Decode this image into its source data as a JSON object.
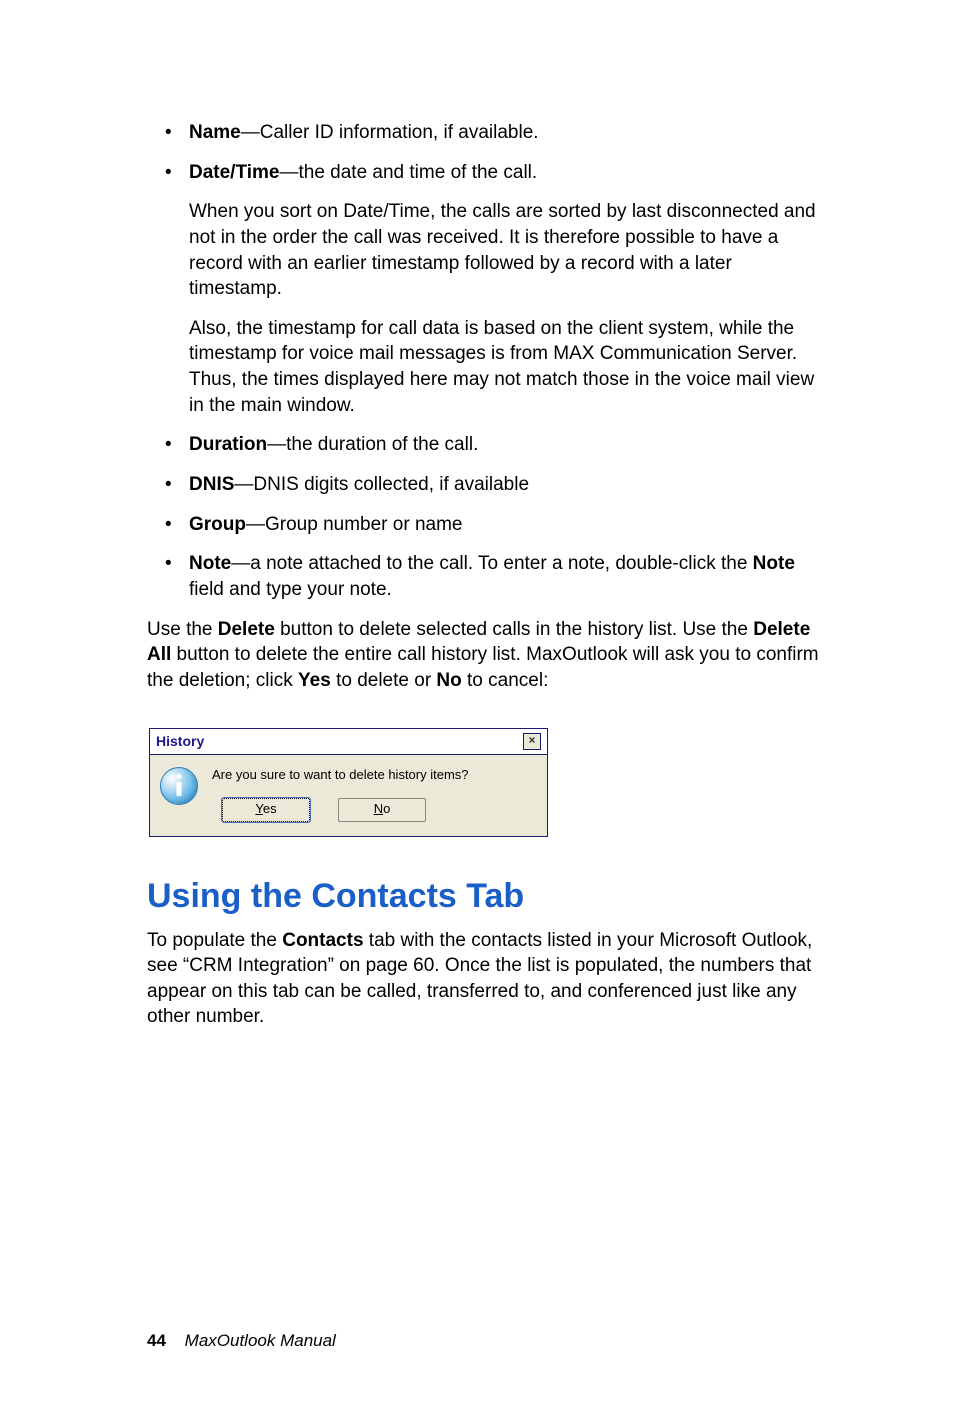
{
  "bullets": {
    "name_label": "Name",
    "name_text": "—Caller ID information, if available.",
    "datetime_label": "Date/Time",
    "datetime_text": "—the date and time of the call.",
    "datetime_p1": "When you sort on Date/Time, the calls are sorted by last disconnected and not in the order the call was received. It is therefore possible to have a record with an earlier timestamp followed by a record with a later timestamp.",
    "datetime_p2": "Also, the timestamp for call data is based on the client system, while the timestamp for voice mail messages is from MAX Communication Server. Thus, the times displayed here may not match those in the voice mail view in the main window.",
    "duration_label": "Duration",
    "duration_text": "—the duration of the call.",
    "dnis_label": "DNIS",
    "dnis_text": "—DNIS digits collected, if available",
    "group_label": "Group",
    "group_text": "—Group number or name",
    "note_label": "Note",
    "note_text1": "—a note attached to the call. To enter a note, double-click the ",
    "note_text2": "Note",
    "note_text3": " field and type your note."
  },
  "delete_para": {
    "p1a": "Use the ",
    "p1b": "Delete",
    "p1c": " button to delete selected calls in the history list. Use the ",
    "p1d": "Delete All",
    "p1e": " button to delete the entire call history list. MaxOutlook will ask you to confirm the deletion; click ",
    "p1f": "Yes",
    "p1g": " to delete or ",
    "p1h": "No",
    "p1i": " to cancel:"
  },
  "dialog": {
    "title": "History",
    "message": "Are you sure to want to delete history items?",
    "yes_u": "Y",
    "yes_rest": "es",
    "no_u": "N",
    "no_rest": "o"
  },
  "heading": "Using the Contacts Tab",
  "contacts": {
    "p1a": "To populate the ",
    "p1b": "Contacts",
    "p1c": " tab with the contacts listed in your Microsoft Outlook, see “CRM Integration” on page 60. Once the list is populated, the numbers that appear on this tab can be called, transferred to, and conferenced just like any other number."
  },
  "footer": {
    "page": "44",
    "book": "MaxOutlook Manual"
  }
}
